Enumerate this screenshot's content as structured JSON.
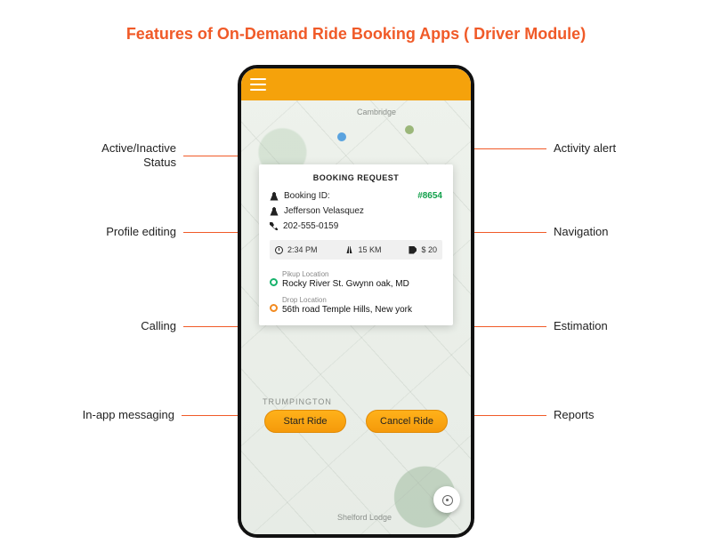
{
  "title": "Features of On-Demand Ride Booking Apps ( Driver Module)",
  "colors": {
    "accent": "#f05a28",
    "brand": "#f5a20b",
    "success": "#12a04b"
  },
  "callouts": {
    "left": [
      "Active/Inactive\nStatus",
      "Profile editing",
      "Calling",
      "In-app messaging"
    ],
    "right": [
      "Activity alert",
      "Navigation",
      "Estimation",
      "Reports"
    ]
  },
  "map": {
    "labels": {
      "cambridge": "Cambridge",
      "trumpington": "TRUMPINGTON",
      "shelford": "Shelford Lodge"
    }
  },
  "app": {
    "menu_icon": "hamburger-icon",
    "card": {
      "title": "BOOKING REQUEST",
      "booking_id_label": "Booking ID:",
      "booking_id_value": "#8654",
      "customer_name": "Jefferson Velasquez",
      "customer_phone": "202-555-0159",
      "stats": {
        "time": "2:34 PM",
        "distance": "15 KM",
        "price": "$ 20"
      },
      "pickup_label": "Pikup Location",
      "pickup_value": "Rocky River St. Gwynn oak, MD",
      "drop_label": "Drop Location",
      "drop_value": "56th road Temple Hills, New york"
    },
    "buttons": {
      "start": "Start Ride",
      "cancel": "Cancel Ride"
    },
    "locate_icon": "crosshair-icon"
  }
}
